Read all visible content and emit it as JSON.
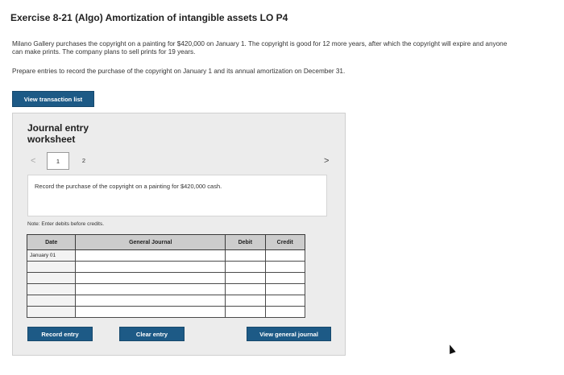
{
  "header": {
    "title": "Exercise 8-21 (Algo) Amortization of intangible assets LO P4"
  },
  "problem": {
    "paragraph1": "Milano Gallery purchases the copyright on a painting for $420,000 on January 1. The copyright is good for 12 more years, after which the copyright will expire and anyone can make prints. The company plans to sell prints for 19 years.",
    "paragraph2": "Prepare entries to record the purchase of the copyright on January 1 and its annual amortization on December 31."
  },
  "buttons": {
    "view_transaction_list": "View transaction list",
    "record_entry": "Record entry",
    "clear_entry": "Clear entry",
    "view_general_journal": "View general journal"
  },
  "worksheet": {
    "title": "Journal entry worksheet",
    "nav_prev": "<",
    "nav_next": ">",
    "tabs": [
      "1",
      "2"
    ],
    "instruction": "Record the purchase of the copyright on a painting for $420,000 cash.",
    "note": "Note: Enter debits before credits."
  },
  "journal": {
    "headers": {
      "date": "Date",
      "general_journal": "General Journal",
      "debit": "Debit",
      "credit": "Credit"
    },
    "rows": [
      {
        "date": "January 01",
        "account": "",
        "debit": "",
        "credit": ""
      },
      {
        "date": "",
        "account": "",
        "debit": "",
        "credit": ""
      },
      {
        "date": "",
        "account": "",
        "debit": "",
        "credit": ""
      },
      {
        "date": "",
        "account": "",
        "debit": "",
        "credit": ""
      },
      {
        "date": "",
        "account": "",
        "debit": "",
        "credit": ""
      },
      {
        "date": "",
        "account": "",
        "debit": "",
        "credit": ""
      }
    ]
  },
  "colors": {
    "button_bg": "#1d5a86",
    "worksheet_bg": "#ececec",
    "table_header_bg": "#cccccc"
  }
}
